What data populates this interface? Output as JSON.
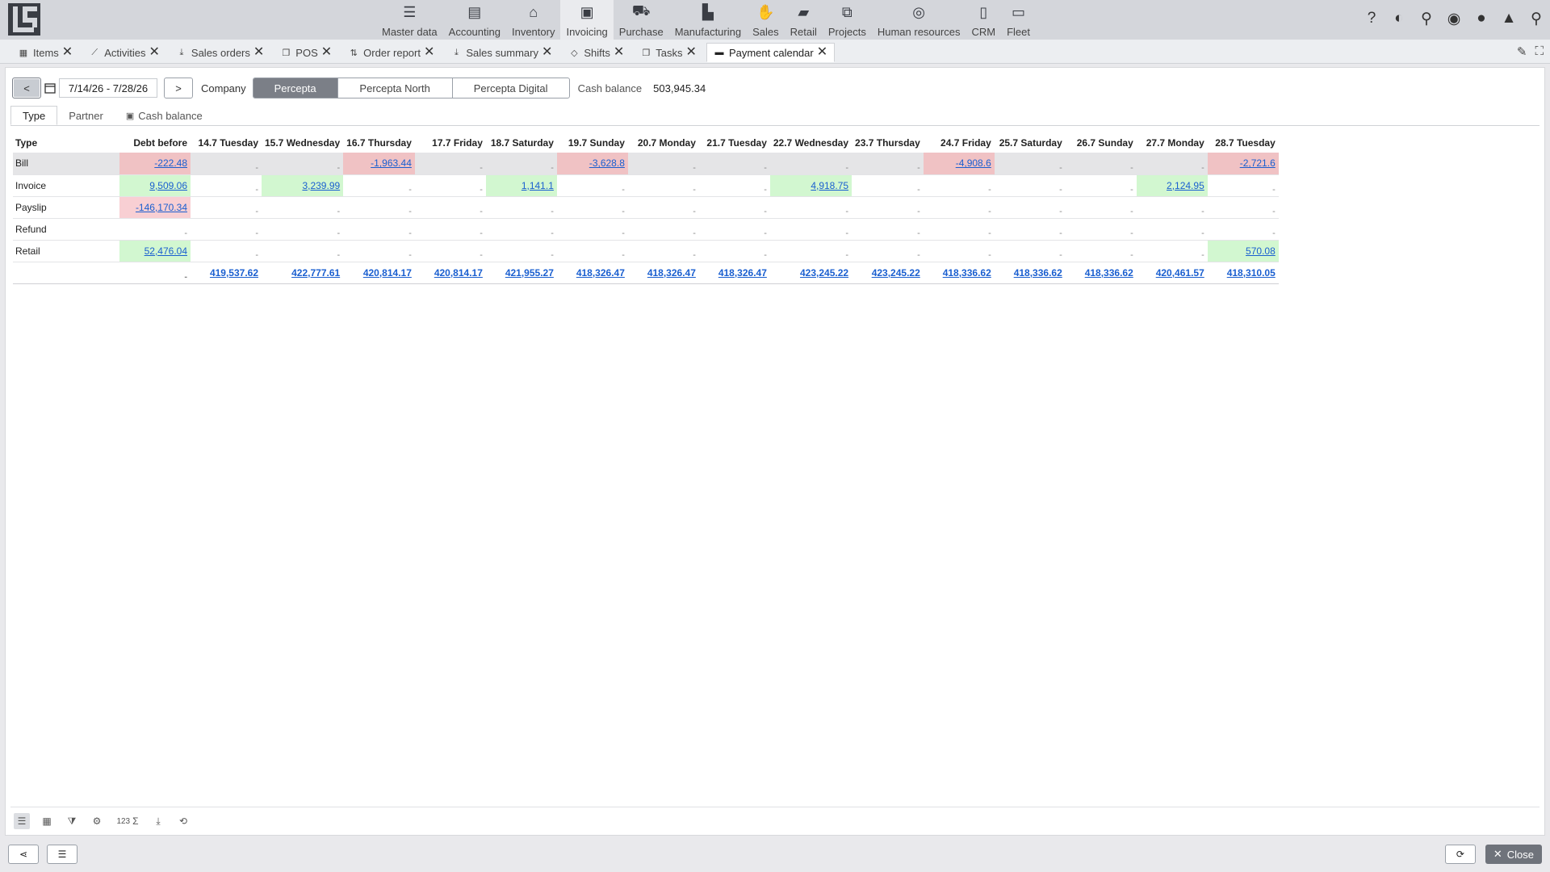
{
  "nav": {
    "modules": [
      {
        "label": "Master data",
        "icon": "checklist-icon"
      },
      {
        "label": "Accounting",
        "icon": "ledger-icon"
      },
      {
        "label": "Inventory",
        "icon": "warehouse-icon"
      },
      {
        "label": "Invoicing",
        "icon": "money-icon"
      },
      {
        "label": "Purchase",
        "icon": "cart-icon"
      },
      {
        "label": "Manufacturing",
        "icon": "factory-icon"
      },
      {
        "label": "Sales",
        "icon": "hand-money-icon"
      },
      {
        "label": "Retail",
        "icon": "shopping-bag-icon"
      },
      {
        "label": "Projects",
        "icon": "network-icon"
      },
      {
        "label": "Human resources",
        "icon": "fingerprint-icon"
      },
      {
        "label": "CRM",
        "icon": "contact-icon"
      },
      {
        "label": "Fleet",
        "icon": "bus-icon"
      }
    ],
    "active_module": "Invoicing",
    "right_icons": [
      "help-icon",
      "contrast-icon",
      "pin-icon",
      "eye-icon",
      "chat-icon",
      "lock-icon",
      "search-icon"
    ]
  },
  "tabs": [
    {
      "label": "Items"
    },
    {
      "label": "Activities"
    },
    {
      "label": "Sales orders"
    },
    {
      "label": "POS"
    },
    {
      "label": "Order report"
    },
    {
      "label": "Sales summary"
    },
    {
      "label": "Shifts"
    },
    {
      "label": "Tasks"
    },
    {
      "label": "Payment calendar"
    }
  ],
  "toolbar": {
    "prev_label": "<",
    "next_label": ">",
    "date_range": "7/14/26 - 7/28/26",
    "company_label": "Company",
    "companies": [
      "Percepta",
      "Percepta North",
      "Percepta Digital"
    ],
    "active_company": "Percepta",
    "cash_balance_label": "Cash balance",
    "cash_balance_value": "503,945.34"
  },
  "subtabs": [
    "Type",
    "Partner",
    "Cash balance"
  ],
  "table": {
    "columns": [
      "Type",
      "Debt before",
      "14.7 Tuesday",
      "15.7 Wednesday",
      "16.7 Thursday",
      "17.7 Friday",
      "18.7 Saturday",
      "19.7 Sunday",
      "20.7 Monday",
      "21.7 Tuesday",
      "22.7 Wednesday",
      "23.7 Thursday",
      "24.7 Friday",
      "25.7 Saturday",
      "26.7 Sunday",
      "27.7 Monday",
      "28.7 Tuesday"
    ],
    "rows": [
      {
        "type": "Bill",
        "cells": [
          "-222.48",
          "",
          "",
          "-1,963.44",
          "",
          "",
          "-3,628.8",
          "",
          "",
          "",
          "",
          "-4,908.6",
          "",
          "",
          "",
          "-2,721.6"
        ]
      },
      {
        "type": "Invoice",
        "cells": [
          "9,509.06",
          "",
          "3,239.99",
          "",
          "",
          "1,141.1",
          "",
          "",
          "",
          "4,918.75",
          "",
          "",
          "",
          "",
          "2,124.95",
          ""
        ]
      },
      {
        "type": "Payslip",
        "cells": [
          "-146,170.34",
          "",
          "",
          "",
          "",
          "",
          "",
          "",
          "",
          "",
          "",
          "",
          "",
          "",
          "",
          ""
        ]
      },
      {
        "type": "Refund",
        "cells": [
          "",
          "",
          "",
          "",
          "",
          "",
          "",
          "",
          "",
          "",
          "",
          "",
          "",
          "",
          "",
          ""
        ]
      },
      {
        "type": "Retail",
        "cells": [
          "52,476.04",
          "",
          "",
          "",
          "",
          "",
          "",
          "",
          "",
          "",
          "",
          "",
          "",
          "",
          "",
          "570.08"
        ]
      }
    ],
    "totals": [
      "",
      "419,537.62",
      "422,777.61",
      "420,814.17",
      "420,814.17",
      "421,955.27",
      "418,326.47",
      "418,326.47",
      "418,326.47",
      "423,245.22",
      "423,245.22",
      "418,336.62",
      "418,336.62",
      "418,336.62",
      "420,461.57",
      "418,310.05"
    ],
    "empty_marker": "-"
  },
  "panel_tools": {
    "sum_label": "123",
    "sigma": "Σ"
  },
  "footer": {
    "close_label": "Close"
  },
  "colors": {
    "negative_bg": "#f0c2c4",
    "positive_bg": "#d2f7d0",
    "link": "#1a5fd0",
    "active_segment": "#7b7f87"
  }
}
